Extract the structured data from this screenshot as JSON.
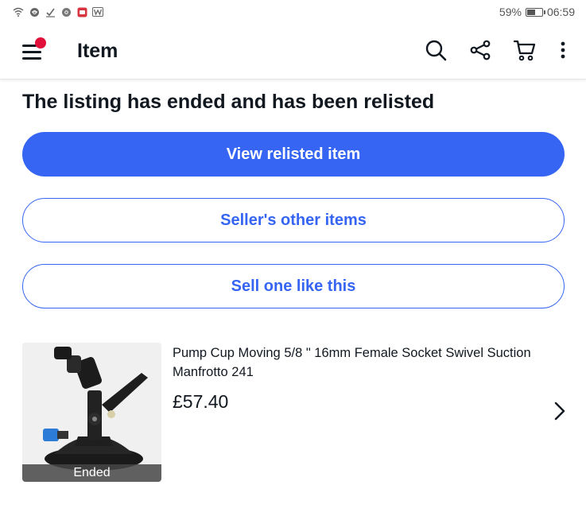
{
  "status_bar": {
    "battery": "59%",
    "battery_level": 0.59,
    "time": "06:59",
    "icons": [
      "wifi-icon",
      "vpn-icon",
      "check-icon",
      "chrome-icon",
      "notification-app-icon",
      "w-app-icon"
    ]
  },
  "app_bar": {
    "title": "Item",
    "icons": [
      "menu-icon",
      "search-icon",
      "share-icon",
      "cart-icon",
      "more-vert-icon"
    ]
  },
  "listing": {
    "heading": "The listing has ended and has been relisted",
    "view_relisted_label": "View relisted item",
    "sellers_other_label": "Seller's other items",
    "sell_one_label": "Sell one like this"
  },
  "item": {
    "title": "Pump Cup Moving 5/8 \" 16mm Female Socket Swivel Suction Manfrotto 241",
    "price": "£57.40",
    "badge": "Ended"
  },
  "colors": {
    "primary": "#3665f3",
    "text": "#111820",
    "notification_dot": "#e0103a"
  }
}
